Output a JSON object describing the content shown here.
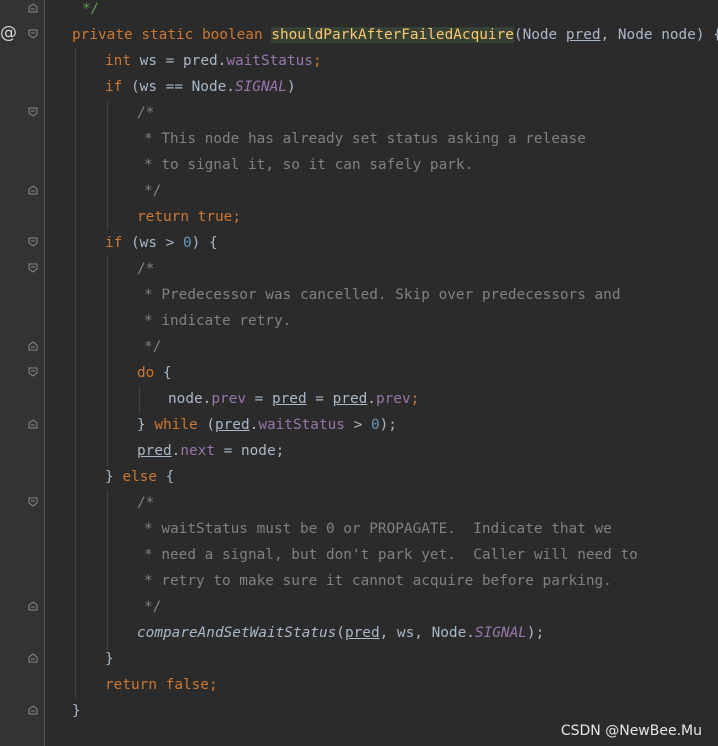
{
  "editor": {
    "language": "Java",
    "theme": "dark",
    "colors": {
      "background": "#2b2b2b",
      "gutter": "#313335",
      "keyword": "#cc7832",
      "comment": "#808080",
      "doc_comment": "#629755",
      "field": "#9876aa",
      "number": "#6897bb",
      "method_declaration": "#ffc66d",
      "plain": "#a9b7c6"
    },
    "override_marker": "@",
    "fold_icon": "fold-chevron-icon"
  },
  "code": {
    "l1": {
      "doc_end": "*/"
    },
    "l2": {
      "kw1": "private",
      "kw2": "static",
      "kw3": "boolean",
      "method": "shouldParkAfterFailedAcquire",
      "open": "(Node ",
      "p1": "pred",
      "sep": ", Node node) {"
    },
    "l3": {
      "type": "int",
      "mid": "ws = pred.",
      "field": "waitStatus",
      "semi": ";"
    },
    "l4": {
      "kw": "if",
      "a": "(ws == Node.",
      "const": "SIGNAL",
      "b": ")"
    },
    "l5": {
      "text": "/*"
    },
    "l6": {
      "text": "* This node has already set status asking a release"
    },
    "l7": {
      "text": "* to signal it, so it can safely park."
    },
    "l8": {
      "text": "*/"
    },
    "l9": {
      "kw1": "return",
      "kw2": "true",
      "semi": ";"
    },
    "l10": {
      "kw": "if",
      "a": "(ws > ",
      "num": "0",
      "b": ") {"
    },
    "l11": {
      "text": "/*"
    },
    "l12": {
      "text": "* Predecessor was cancelled. Skip over predecessors and"
    },
    "l13": {
      "text": "* indicate retry."
    },
    "l14": {
      "text": "*/"
    },
    "l15": {
      "kw": "do",
      "b": " {"
    },
    "l16": {
      "a": "node.",
      "f1": "prev",
      "eq1": " = ",
      "v1": "pred",
      "eq2": " = ",
      "v2": "pred",
      "dot": ".",
      "f2": "prev",
      "semi": ";"
    },
    "l17": {
      "a": "} ",
      "kw": "while",
      "b": " (",
      "v": "pred",
      "dot": ".",
      "f": "waitStatus",
      "c": " > ",
      "num": "0",
      "d": ");"
    },
    "l18": {
      "v": "pred",
      "dot": ".",
      "f": "next",
      "b": " = node;"
    },
    "l19": {
      "a": "} ",
      "kw": "else",
      "b": " {"
    },
    "l20": {
      "text": "/*"
    },
    "l21": {
      "text": "* waitStatus must be 0 or PROPAGATE.  Indicate that we"
    },
    "l22": {
      "text": "* need a signal, but don't park yet.  Caller will need to"
    },
    "l23": {
      "text": "* retry to make sure it cannot acquire before parking."
    },
    "l24": {
      "text": "*/"
    },
    "l25": {
      "call": "compareAndSetWaitStatus",
      "a": "(",
      "v": "pred",
      "b": ", ws, Node.",
      "const": "SIGNAL",
      "c": ");"
    },
    "l26": {
      "text": "}"
    },
    "l27": {
      "kw1": "return",
      "kw2": "false",
      "semi": ";"
    },
    "l28": {
      "text": "}"
    }
  },
  "watermark": "CSDN @NewBee.Mu"
}
